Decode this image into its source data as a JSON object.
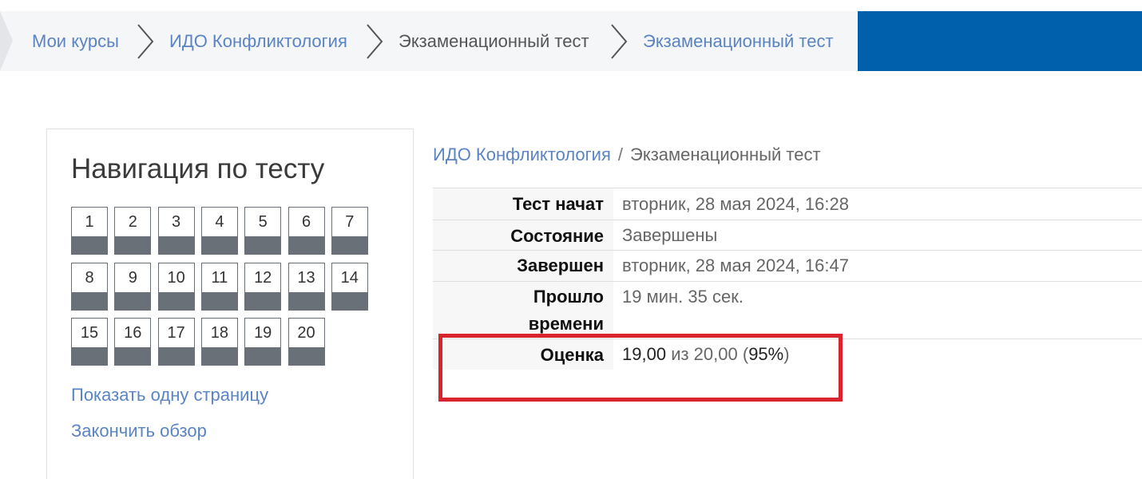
{
  "breadcrumb": {
    "items": [
      {
        "label": "Мои курсы",
        "kind": "link"
      },
      {
        "label": "ИДО Конфликтология",
        "kind": "link"
      },
      {
        "label": "Экзаменационный тест",
        "kind": "current"
      },
      {
        "label": "Экзаменационный тест",
        "kind": "link"
      }
    ]
  },
  "nav": {
    "title": "Навигация по тесту",
    "questions": [
      "1",
      "2",
      "3",
      "4",
      "5",
      "6",
      "7",
      "8",
      "9",
      "10",
      "11",
      "12",
      "13",
      "14",
      "15",
      "16",
      "17",
      "18",
      "19",
      "20"
    ],
    "show_one_page": "Показать одну страницу",
    "finish_review": "Закончить обзор"
  },
  "summary": {
    "crumb_course": "ИДО Конфликтология",
    "crumb_sep": "/",
    "crumb_test": "Экзаменационный тест",
    "rows": [
      {
        "label": "Тест начат",
        "value": "вторник, 28 мая 2024, 16:28"
      },
      {
        "label": "Состояние",
        "value": "Завершены"
      },
      {
        "label": "Завершен",
        "value": "вторник, 28 мая 2024, 16:47"
      },
      {
        "label": "Прошло времени",
        "value": "19 мин. 35 сек."
      }
    ],
    "grade": {
      "label": "Оценка",
      "score": "19,00",
      "of_text": "из 20,00",
      "percent_open": "(",
      "percent": "95%",
      "percent_close": ")"
    }
  },
  "colors": {
    "accent_blue": "#0060ac",
    "link": "#5a84c4",
    "highlight_red": "#d9232d",
    "question_bar": "#6a7078"
  }
}
